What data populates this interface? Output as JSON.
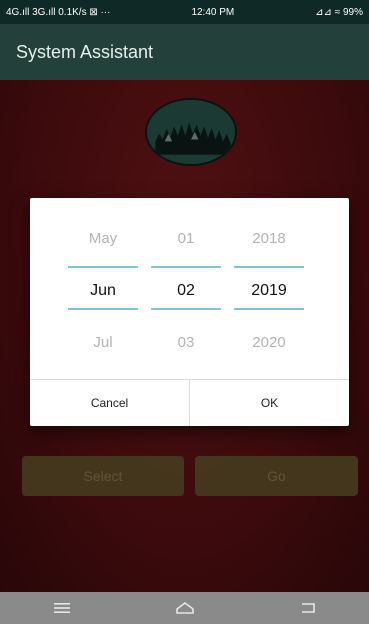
{
  "status_bar": {
    "left_text": "4G.ıll 3G.ıll 0.1K/s ⊠ ···",
    "time": "12:40 PM",
    "right_text": "⊿⊿ ≈ 99%"
  },
  "app_bar": {
    "title": "System Assistant"
  },
  "dialog": {
    "month": {
      "prev": "May",
      "selected": "Jun",
      "next": "Jul"
    },
    "day": {
      "prev": "01",
      "selected": "02",
      "next": "03"
    },
    "year": {
      "prev": "2018",
      "selected": "2019",
      "next": "2020"
    },
    "buttons": {
      "cancel": "Cancel",
      "ok": "OK"
    }
  },
  "background_buttons": {
    "left": "Select",
    "right": "Go"
  },
  "colors": {
    "status_bar": "#0f2a26",
    "app_bar": "#23403a",
    "content_bg": "#5f1114",
    "divider": "#7fc6d8",
    "nav_bar": "#8a8a8a"
  },
  "icons": {
    "avatar": "tree-silhouette-avatar",
    "nav_menu": "menu-icon",
    "nav_home": "home-icon",
    "nav_back": "back-icon"
  }
}
